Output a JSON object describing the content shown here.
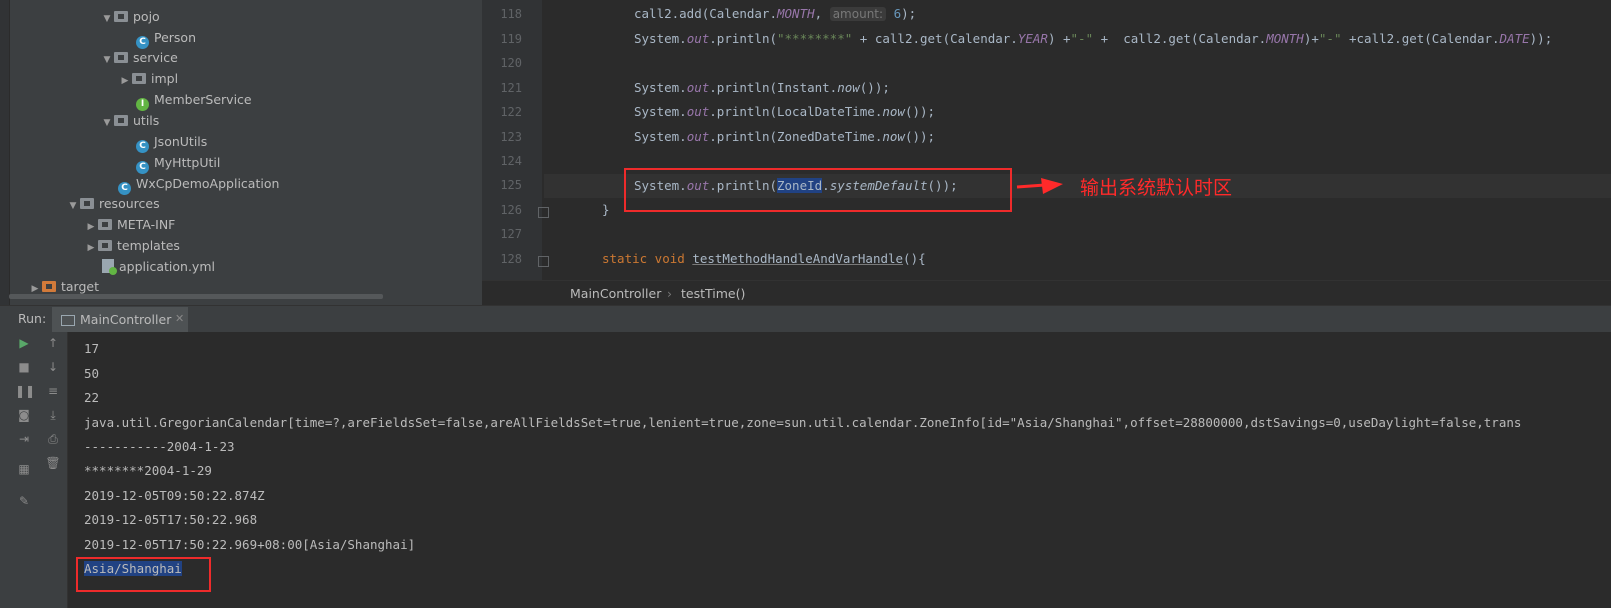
{
  "project_tree": {
    "items": [
      {
        "label": "pojo",
        "type": "folder",
        "expanded": true
      },
      {
        "label": "Person",
        "type": "class"
      },
      {
        "label": "service",
        "type": "folder",
        "expanded": true
      },
      {
        "label": "impl",
        "type": "folder",
        "expanded": false
      },
      {
        "label": "MemberService",
        "type": "interface"
      },
      {
        "label": "utils",
        "type": "folder",
        "expanded": true
      },
      {
        "label": "JsonUtils",
        "type": "class"
      },
      {
        "label": "MyHttpUtil",
        "type": "class"
      },
      {
        "label": "WxCpDemoApplication",
        "type": "spring-app"
      },
      {
        "label": "resources",
        "type": "folder",
        "expanded": true
      },
      {
        "label": "META-INF",
        "type": "folder",
        "expanded": false
      },
      {
        "label": "templates",
        "type": "folder",
        "expanded": false
      },
      {
        "label": "application.yml",
        "type": "yml"
      },
      {
        "label": "target",
        "type": "folder",
        "expanded": false
      }
    ]
  },
  "editor": {
    "line_numbers": [
      "118",
      "119",
      "120",
      "121",
      "122",
      "123",
      "124",
      "125",
      "126",
      "127",
      "128"
    ],
    "lines": {
      "l118": {
        "a": "call2.add(Calendar.",
        "b": "MONTH",
        "c": ",",
        "hint": "amount:",
        "d": "6",
        "e": ");"
      },
      "l119": {
        "a": "System.",
        "b": "out",
        "c": ".println(",
        "d": "\"********\"",
        "e": " + call2.get(Calendar.",
        "f": "YEAR",
        "g": ") +",
        "h": "\"-\"",
        "i": " +  call2.get(Calendar.",
        "j": "MONTH",
        "k": ")+",
        "l": "\"-\"",
        "m": " +call2.get(Calendar.",
        "n": "DATE",
        "o": "));"
      },
      "l121": {
        "a": "System.",
        "b": "out",
        "c": ".println(Instant.",
        "d": "now",
        "e": "());"
      },
      "l122": {
        "a": "System.",
        "b": "out",
        "c": ".println(LocalDateTime.",
        "d": "now",
        "e": "());"
      },
      "l123": {
        "a": "System.",
        "b": "out",
        "c": ".println(ZonedDateTime.",
        "d": "now",
        "e": "());"
      },
      "l125": {
        "a": "System.",
        "b": "out",
        "c": ".println(",
        "d": "ZoneId",
        "e": ".",
        "f": "systemDefault",
        "g": "());"
      },
      "l126": {
        "a": "}"
      },
      "l128": {
        "a": "static void",
        "b": " ",
        "c": "testMethodHandleAndVarHandle",
        "d": "(){"
      }
    }
  },
  "breadcrumb": {
    "class": "MainController",
    "separator": "›",
    "method": "testTime()"
  },
  "annotation": {
    "text": "输出系统默认时区",
    "color": "#ff2a2a"
  },
  "run_panel": {
    "label": "Run:",
    "tab_label": "MainController",
    "console_lines": [
      "17",
      "50",
      "22",
      "java.util.GregorianCalendar[time=?,areFieldsSet=false,areAllFieldsSet=true,lenient=true,zone=sun.util.calendar.ZoneInfo[id=\"Asia/Shanghai\",offset=28800000,dstSavings=0,useDaylight=false,trans",
      "-----------2004-1-23",
      "********2004-1-29",
      "2019-12-05T09:50:22.874Z",
      "2019-12-05T17:50:22.968",
      "2019-12-05T17:50:22.969+08:00[Asia/Shanghai]",
      "Asia/Shanghai"
    ]
  },
  "colors": {
    "keyword": "#cc7832",
    "static_field": "#9876aa",
    "string": "#6a8759",
    "number": "#6897bb",
    "selection": "#214283",
    "highlight_box": "#ee2b2b"
  }
}
